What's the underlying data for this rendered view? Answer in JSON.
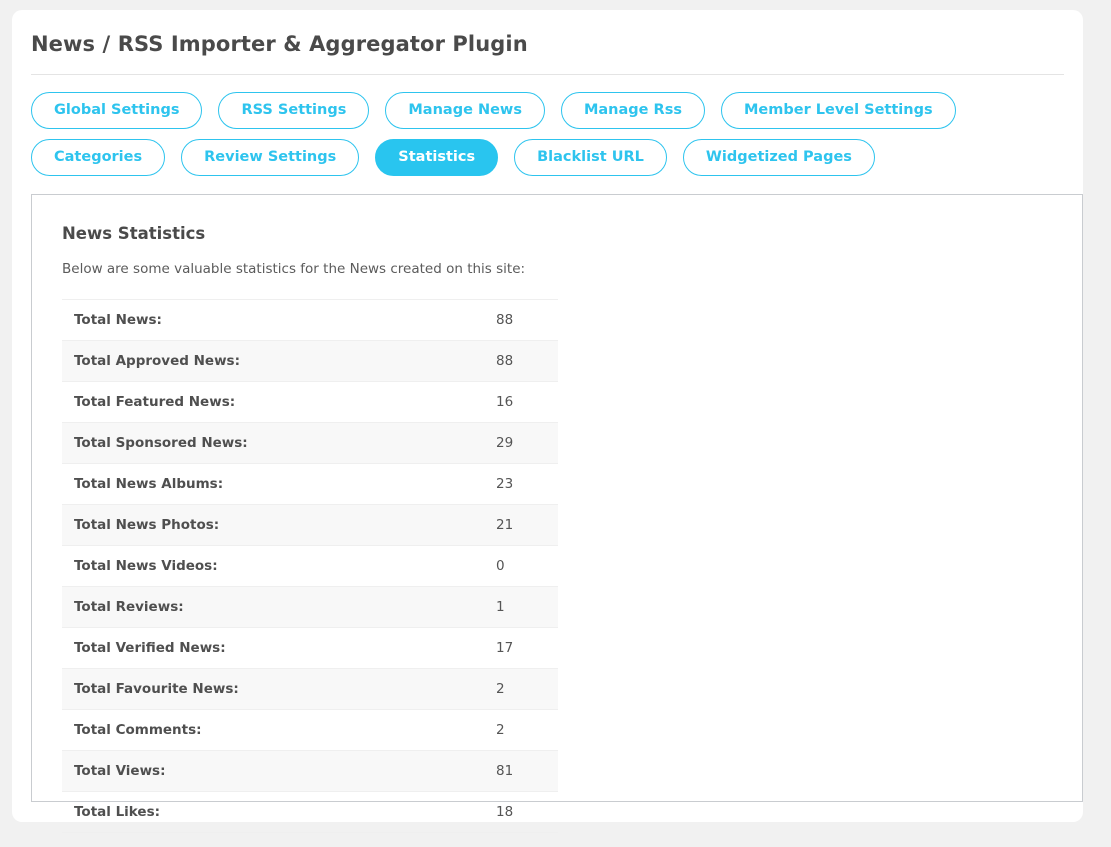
{
  "header": {
    "title": "News / RSS Importer & Aggregator Plugin"
  },
  "tabs": [
    {
      "label": "Global Settings",
      "active": false
    },
    {
      "label": "RSS Settings",
      "active": false
    },
    {
      "label": "Manage News",
      "active": false
    },
    {
      "label": "Manage Rss",
      "active": false
    },
    {
      "label": "Member Level Settings",
      "active": false
    },
    {
      "label": "Categories",
      "active": false
    },
    {
      "label": "Review Settings",
      "active": false
    },
    {
      "label": "Statistics",
      "active": true
    },
    {
      "label": "Blacklist URL",
      "active": false
    },
    {
      "label": "Widgetized Pages",
      "active": false
    }
  ],
  "panel": {
    "heading": "News Statistics",
    "description": "Below are some valuable statistics for the News created on this site:",
    "rows": [
      {
        "label": "Total News:",
        "value": "88"
      },
      {
        "label": "Total Approved News:",
        "value": "88"
      },
      {
        "label": "Total Featured News:",
        "value": "16"
      },
      {
        "label": "Total Sponsored News:",
        "value": "29"
      },
      {
        "label": "Total News Albums:",
        "value": "23"
      },
      {
        "label": "Total News Photos:",
        "value": "21"
      },
      {
        "label": "Total News Videos:",
        "value": "0"
      },
      {
        "label": "Total Reviews:",
        "value": "1"
      },
      {
        "label": "Total Verified News:",
        "value": "17"
      },
      {
        "label": "Total Favourite News:",
        "value": "2"
      },
      {
        "label": "Total Comments:",
        "value": "2"
      },
      {
        "label": "Total Views:",
        "value": "81"
      },
      {
        "label": "Total Likes:",
        "value": "18"
      }
    ]
  },
  "colors": {
    "accent": "#29c5ef",
    "page_background": "#f1f1f1",
    "card_background": "#ffffff",
    "panel_border": "#c9ccd0",
    "row_stripe": "#f8f8f8",
    "text_dark": "#4a4a4a"
  }
}
